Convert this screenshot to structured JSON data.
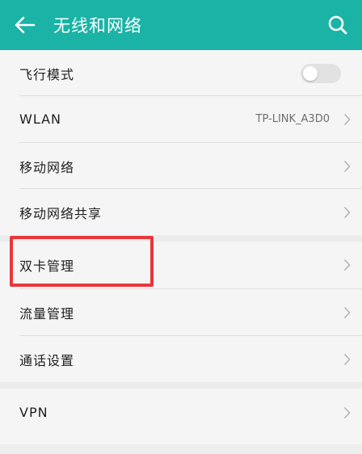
{
  "header": {
    "title": "无线和网络",
    "back_icon": "arrow-left-icon",
    "search_icon": "search-icon",
    "bg_color": "#1ab3a6"
  },
  "items": [
    {
      "label": "飞行模式",
      "type": "toggle",
      "toggle_on": false
    },
    {
      "label": "WLAN",
      "value": "TP-LINK_A3D0"
    },
    {
      "label": "移动网络"
    },
    {
      "label": "移动网络共享"
    },
    {
      "label": "双卡管理",
      "highlighted": true
    },
    {
      "label": "流量管理"
    },
    {
      "label": "通话设置"
    },
    {
      "label": "VPN"
    }
  ],
  "highlight_color": "#e8373a"
}
